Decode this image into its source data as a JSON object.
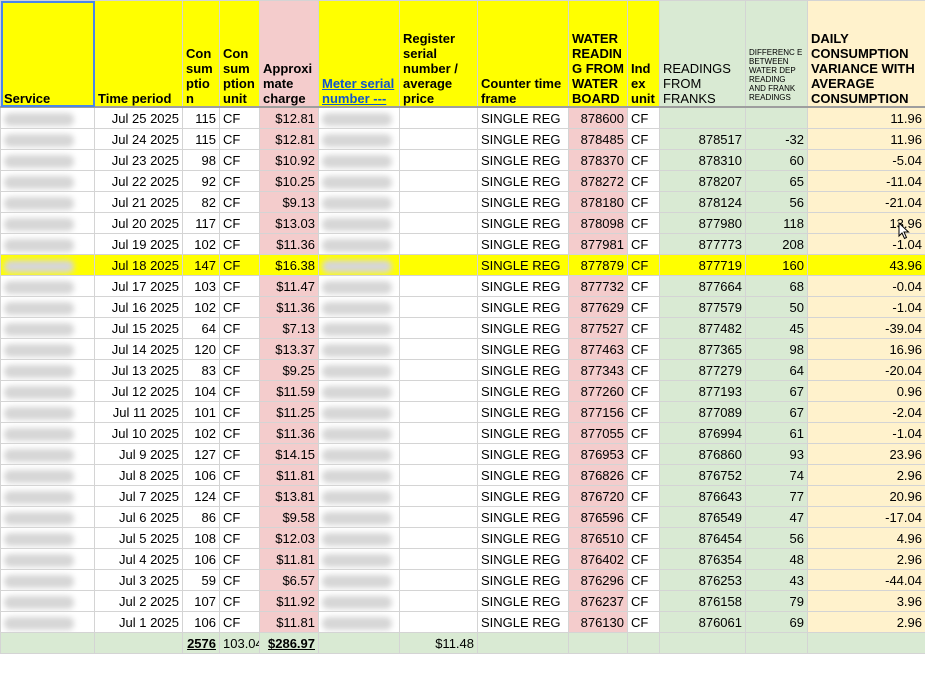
{
  "headers": {
    "service": "Service",
    "time_period": "Time period",
    "consumption": "Con sum ptio n",
    "consumption_unit": "Con sum ption unit",
    "approx_charge": "Approxi mate charge",
    "meter_serial": "Meter serial number ---",
    "register_serial": "Register serial number / average price",
    "counter_time_frame": "Counter time frame",
    "water_reading": "WATER READIN G FROM WATER BOARD",
    "index_unit": "Ind ex unit",
    "readings_franks": "READINGS FROM FRANKS",
    "difference": "DIFFERENC E BETWEEN WATER DEP READING AND FRANK READINGS",
    "daily_variance": "DAILY CONSUMPTION VARIANCE WITH AVERAGE CONSUMPTION"
  },
  "rows": [
    {
      "date": "Jul 25 2025",
      "cons": "115",
      "unit": "CF",
      "charge": "$12.81",
      "frame": "SINGLE REG",
      "reading": "878600",
      "iu": "CF",
      "franks": "",
      "diff": "",
      "var": "11.96"
    },
    {
      "date": "Jul 24 2025",
      "cons": "115",
      "unit": "CF",
      "charge": "$12.81",
      "frame": "SINGLE REG",
      "reading": "878485",
      "iu": "CF",
      "franks": "878517",
      "diff": "-32",
      "var": "11.96"
    },
    {
      "date": "Jul 23 2025",
      "cons": "98",
      "unit": "CF",
      "charge": "$10.92",
      "frame": "SINGLE REG",
      "reading": "878370",
      "iu": "CF",
      "franks": "878310",
      "diff": "60",
      "var": "-5.04"
    },
    {
      "date": "Jul 22 2025",
      "cons": "92",
      "unit": "CF",
      "charge": "$10.25",
      "frame": "SINGLE REG",
      "reading": "878272",
      "iu": "CF",
      "franks": "878207",
      "diff": "65",
      "var": "-11.04"
    },
    {
      "date": "Jul 21 2025",
      "cons": "82",
      "unit": "CF",
      "charge": "$9.13",
      "frame": "SINGLE REG",
      "reading": "878180",
      "iu": "CF",
      "franks": "878124",
      "diff": "56",
      "var": "-21.04"
    },
    {
      "date": "Jul 20 2025",
      "cons": "117",
      "unit": "CF",
      "charge": "$13.03",
      "frame": "SINGLE REG",
      "reading": "878098",
      "iu": "CF",
      "franks": "877980",
      "diff": "118",
      "var": "13.96"
    },
    {
      "date": "Jul 19 2025",
      "cons": "102",
      "unit": "CF",
      "charge": "$11.36",
      "frame": "SINGLE REG",
      "reading": "877981",
      "iu": "CF",
      "franks": "877773",
      "diff": "208",
      "var": "-1.04"
    },
    {
      "date": "Jul 18 2025",
      "cons": "147",
      "unit": "CF",
      "charge": "$16.38",
      "frame": "SINGLE REG",
      "reading": "877879",
      "iu": "CF",
      "franks": "877719",
      "diff": "160",
      "var": "43.96"
    },
    {
      "date": "Jul 17 2025",
      "cons": "103",
      "unit": "CF",
      "charge": "$11.47",
      "frame": "SINGLE REG",
      "reading": "877732",
      "iu": "CF",
      "franks": "877664",
      "diff": "68",
      "var": "-0.04"
    },
    {
      "date": "Jul 16 2025",
      "cons": "102",
      "unit": "CF",
      "charge": "$11.36",
      "frame": "SINGLE REG",
      "reading": "877629",
      "iu": "CF",
      "franks": "877579",
      "diff": "50",
      "var": "-1.04"
    },
    {
      "date": "Jul 15 2025",
      "cons": "64",
      "unit": "CF",
      "charge": "$7.13",
      "frame": "SINGLE REG",
      "reading": "877527",
      "iu": "CF",
      "franks": "877482",
      "diff": "45",
      "var": "-39.04"
    },
    {
      "date": "Jul 14 2025",
      "cons": "120",
      "unit": "CF",
      "charge": "$13.37",
      "frame": "SINGLE REG",
      "reading": "877463",
      "iu": "CF",
      "franks": "877365",
      "diff": "98",
      "var": "16.96"
    },
    {
      "date": "Jul 13 2025",
      "cons": "83",
      "unit": "CF",
      "charge": "$9.25",
      "frame": "SINGLE REG",
      "reading": "877343",
      "iu": "CF",
      "franks": "877279",
      "diff": "64",
      "var": "-20.04"
    },
    {
      "date": "Jul 12 2025",
      "cons": "104",
      "unit": "CF",
      "charge": "$11.59",
      "frame": "SINGLE REG",
      "reading": "877260",
      "iu": "CF",
      "franks": "877193",
      "diff": "67",
      "var": "0.96"
    },
    {
      "date": "Jul 11 2025",
      "cons": "101",
      "unit": "CF",
      "charge": "$11.25",
      "frame": "SINGLE REG",
      "reading": "877156",
      "iu": "CF",
      "franks": "877089",
      "diff": "67",
      "var": "-2.04"
    },
    {
      "date": "Jul 10 2025",
      "cons": "102",
      "unit": "CF",
      "charge": "$11.36",
      "frame": "SINGLE REG",
      "reading": "877055",
      "iu": "CF",
      "franks": "876994",
      "diff": "61",
      "var": "-1.04"
    },
    {
      "date": "Jul 9 2025",
      "cons": "127",
      "unit": "CF",
      "charge": "$14.15",
      "frame": "SINGLE REG",
      "reading": "876953",
      "iu": "CF",
      "franks": "876860",
      "diff": "93",
      "var": "23.96"
    },
    {
      "date": "Jul 8 2025",
      "cons": "106",
      "unit": "CF",
      "charge": "$11.81",
      "frame": "SINGLE REG",
      "reading": "876826",
      "iu": "CF",
      "franks": "876752",
      "diff": "74",
      "var": "2.96"
    },
    {
      "date": "Jul 7 2025",
      "cons": "124",
      "unit": "CF",
      "charge": "$13.81",
      "frame": "SINGLE REG",
      "reading": "876720",
      "iu": "CF",
      "franks": "876643",
      "diff": "77",
      "var": "20.96"
    },
    {
      "date": "Jul 6 2025",
      "cons": "86",
      "unit": "CF",
      "charge": "$9.58",
      "frame": "SINGLE REG",
      "reading": "876596",
      "iu": "CF",
      "franks": "876549",
      "diff": "47",
      "var": "-17.04"
    },
    {
      "date": "Jul 5 2025",
      "cons": "108",
      "unit": "CF",
      "charge": "$12.03",
      "frame": "SINGLE REG",
      "reading": "876510",
      "iu": "CF",
      "franks": "876454",
      "diff": "56",
      "var": "4.96"
    },
    {
      "date": "Jul 4 2025",
      "cons": "106",
      "unit": "CF",
      "charge": "$11.81",
      "frame": "SINGLE REG",
      "reading": "876402",
      "iu": "CF",
      "franks": "876354",
      "diff": "48",
      "var": "2.96"
    },
    {
      "date": "Jul 3 2025",
      "cons": "59",
      "unit": "CF",
      "charge": "$6.57",
      "frame": "SINGLE REG",
      "reading": "876296",
      "iu": "CF",
      "franks": "876253",
      "diff": "43",
      "var": "-44.04"
    },
    {
      "date": "Jul 2 2025",
      "cons": "107",
      "unit": "CF",
      "charge": "$11.92",
      "frame": "SINGLE REG",
      "reading": "876237",
      "iu": "CF",
      "franks": "876158",
      "diff": "79",
      "var": "3.96"
    },
    {
      "date": "Jul 1 2025",
      "cons": "106",
      "unit": "CF",
      "charge": "$11.81",
      "frame": "SINGLE REG",
      "reading": "876130",
      "iu": "CF",
      "franks": "876061",
      "diff": "69",
      "var": "2.96"
    }
  ],
  "highlight_date": "Jul 18 2025",
  "totals": {
    "consumption": "2576",
    "unit": "103.04",
    "charge": "$286.97",
    "average_price": "$11.48"
  },
  "colors": {
    "header_yellow": "#ffff00",
    "pink": "#f4cccc",
    "green": "#d9ead3",
    "peach": "#fff2cc",
    "highlight": "#ffff00"
  }
}
